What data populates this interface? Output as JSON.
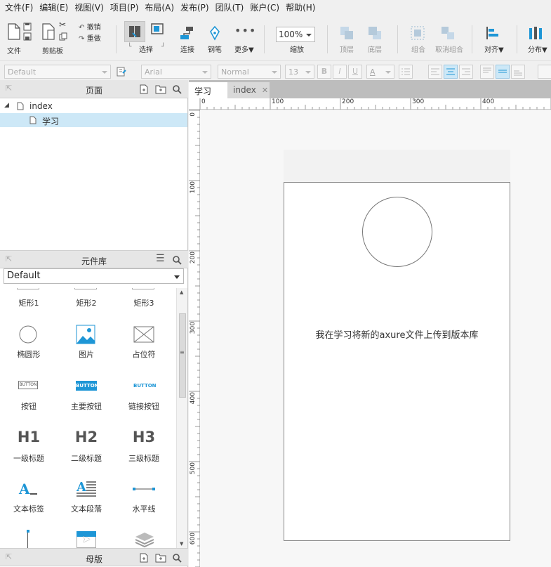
{
  "menu": [
    "文件(F)",
    "编辑(E)",
    "视图(V)",
    "项目(P)",
    "布局(A)",
    "发布(P)",
    "团队(T)",
    "账户(C)",
    "帮助(H)"
  ],
  "toolbar": {
    "file": "文件",
    "clipboard": "剪贴板",
    "undo": "撤销",
    "redo": "重做",
    "select": "选择",
    "connect": "连接",
    "pen": "钢笔",
    "more": "更多▼",
    "zoom_value": "100%",
    "zoom": "缩放",
    "top": "顶层",
    "bottom": "底层",
    "group": "组合",
    "ungroup": "取消组合",
    "align": "对齐▼",
    "distribute": "分布▼"
  },
  "format": {
    "style": "Default",
    "font": "Arial",
    "weight": "Normal",
    "size": "13",
    "bold": "B",
    "italic": "I",
    "underline": "U",
    "color": "A"
  },
  "pages_panel": {
    "title": "页面",
    "items": [
      {
        "label": "index"
      },
      {
        "label": "学习"
      }
    ]
  },
  "library_panel": {
    "title": "元件库",
    "selected_library": "Default",
    "widgets": [
      {
        "label": "矩形1"
      },
      {
        "label": "矩形2"
      },
      {
        "label": "矩形3"
      },
      {
        "label": "椭圆形"
      },
      {
        "label": "图片"
      },
      {
        "label": "占位符"
      },
      {
        "label": "按钮",
        "icon_text": "BUTTON"
      },
      {
        "label": "主要按钮",
        "icon_text": "BUTTON"
      },
      {
        "label": "链接按钮",
        "icon_text": "BUTTON"
      },
      {
        "label": "一级标题",
        "icon_text": "H1"
      },
      {
        "label": "二级标题",
        "icon_text": "H2"
      },
      {
        "label": "三级标题",
        "icon_text": "H3"
      },
      {
        "label": "文本标签"
      },
      {
        "label": "文本段落"
      },
      {
        "label": "水平线"
      }
    ]
  },
  "masters_panel": {
    "title": "母版"
  },
  "tabs": [
    {
      "label": "学习",
      "active": true
    },
    {
      "label": "index",
      "active": false
    }
  ],
  "ruler": {
    "h_ticks": [
      "0",
      "100",
      "200",
      "300",
      "400"
    ],
    "v_ticks": [
      "0",
      "100",
      "200",
      "300",
      "400",
      "500",
      "600"
    ]
  },
  "canvas": {
    "text": "我在学习将新的axure文件上传到版本库"
  },
  "colors": {
    "accent": "#1e96d6",
    "selected_row": "#cde8f7"
  }
}
